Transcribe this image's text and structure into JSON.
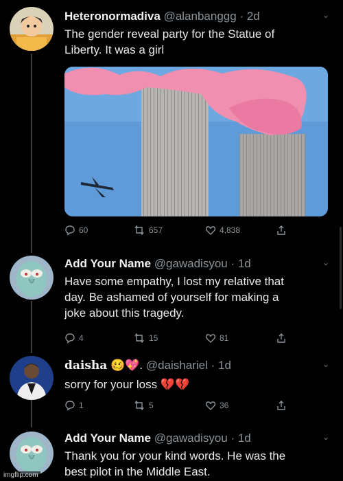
{
  "tweets": [
    {
      "name": "Heteronormadiva",
      "handle": "@alanbanggg",
      "time": "· 2d",
      "lines": [
        "The gender reveal party for the Statue of",
        "Liberty. It was a girl"
      ],
      "replies": "60",
      "retweets": "657",
      "likes": "4,838"
    },
    {
      "name": "Add Your Name",
      "handle": "@gawadisyou",
      "time": "· 1d",
      "lines": [
        "Have some empathy, I lost my relative that",
        "day.  Be ashamed of yourself for making a",
        "joke about this tragedy."
      ],
      "replies": "4",
      "retweets": "15",
      "likes": "81"
    },
    {
      "name": "daisha",
      "name_emoji": "🥴💖.",
      "handle": "@daishariel",
      "time": "· 1d",
      "lines": [
        "sorry for your loss 💔💔"
      ],
      "replies": "1",
      "retweets": "5",
      "likes": "36"
    },
    {
      "name": "Add Your Name",
      "handle": "@gawadisyou",
      "time": "· 1d",
      "lines": [
        "Thank you for your kind words. He was the",
        "best pilot in the Middle East."
      ]
    }
  ],
  "watermark": "imgflip.com",
  "colors": {
    "background": "#000000",
    "text": "#e6e6e6",
    "muted": "#8b9399",
    "smoke": "#f08fb0",
    "sky": "#5f9bd9"
  }
}
